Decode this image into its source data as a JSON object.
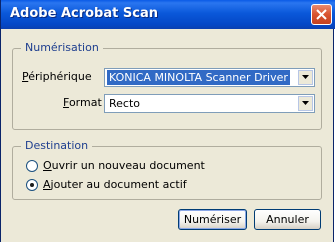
{
  "window": {
    "title": "Adobe Acrobat Scan"
  },
  "scan_group": {
    "legend": "Numérisation",
    "device": {
      "label_accel": "P",
      "label_rest": "ériphérique",
      "value": "KONICA MINOLTA Scanner Driver"
    },
    "format": {
      "label_accel": "F",
      "label_rest": "ormat",
      "value": "Recto"
    }
  },
  "destination_group": {
    "legend": "Destination",
    "options": [
      {
        "accel": "O",
        "rest": "uvrir un nouveau document",
        "checked": false
      },
      {
        "accel": "A",
        "rest": "jouter au document actif",
        "checked": true
      }
    ]
  },
  "buttons": {
    "scan": "Numériser",
    "cancel": "Annuler"
  }
}
